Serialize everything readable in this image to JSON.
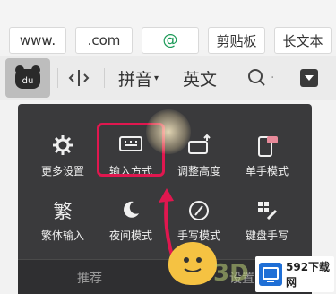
{
  "quick_row": {
    "buttons": [
      {
        "label": "www."
      },
      {
        "label": ".com"
      },
      {
        "label": "@"
      },
      {
        "label": "剪贴板"
      },
      {
        "label": "长文本"
      }
    ]
  },
  "toolbar": {
    "cursor_move_icon": "cursor-move-icon",
    "pinyin_label": "拼音",
    "english_label": "英文",
    "search_icon": "search-icon",
    "collapse_icon": "collapse-down-icon"
  },
  "menu": {
    "row1": [
      {
        "label": "更多设置",
        "icon": "gear-icon"
      },
      {
        "label": "输入方式",
        "icon": "keyboard-icon"
      },
      {
        "label": "调整高度",
        "icon": "adjust-height-icon"
      },
      {
        "label": "单手模式",
        "icon": "one-hand-icon"
      }
    ],
    "row2": [
      {
        "label": "繁体输入",
        "icon": "traditional-char-icon"
      },
      {
        "label": "夜间模式",
        "icon": "moon-icon"
      },
      {
        "label": "手写模式",
        "icon": "handwriting-icon"
      },
      {
        "label": "键盘手写",
        "icon": "keyboard-handwrite-icon"
      }
    ],
    "tabs": [
      {
        "label": "推荐"
      },
      {
        "label": "设置"
      }
    ]
  },
  "watermark": {
    "brand": "3D",
    "label": "592下载网"
  },
  "colors": {
    "highlight": "#e0174f",
    "panel_bg": "#3a3a3c",
    "at_green": "#1b9a57"
  }
}
